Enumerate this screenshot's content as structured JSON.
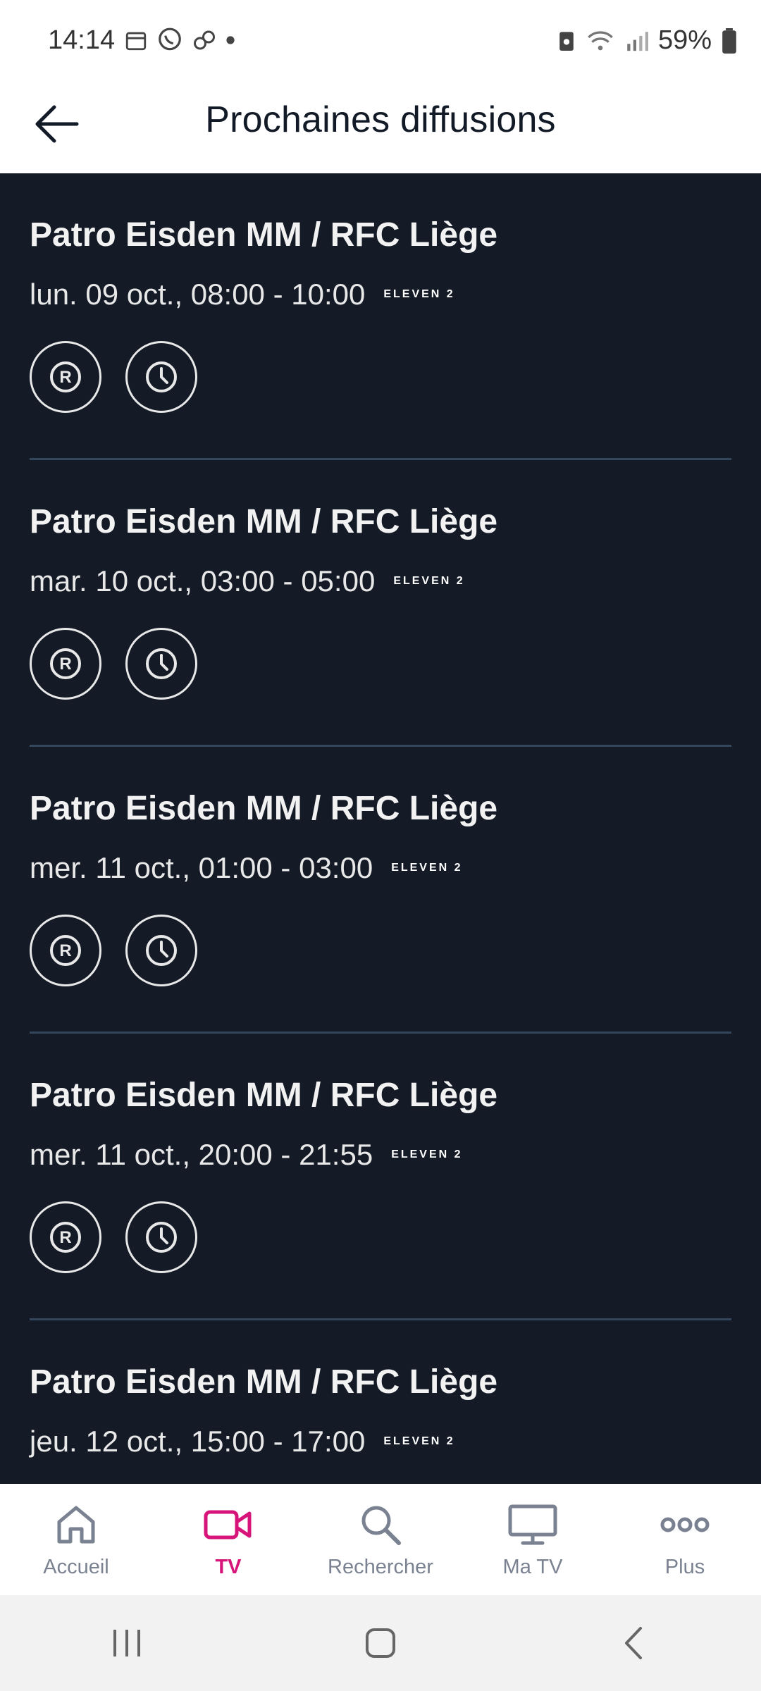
{
  "status_bar": {
    "time": "14:14",
    "battery": "59%"
  },
  "header": {
    "title": "Prochaines diffusions"
  },
  "broadcasts": [
    {
      "title": "Patro Eisden MM / RFC Liège",
      "time": "lun. 09 oct., 08:00 - 10:00",
      "channel": "ELEVEN 2"
    },
    {
      "title": "Patro Eisden MM / RFC Liège",
      "time": "mar. 10 oct., 03:00 - 05:00",
      "channel": "ELEVEN 2"
    },
    {
      "title": "Patro Eisden MM / RFC Liège",
      "time": "mer. 11 oct., 01:00 - 03:00",
      "channel": "ELEVEN 2"
    },
    {
      "title": "Patro Eisden MM / RFC Liège",
      "time": "mer. 11 oct., 20:00 - 21:55",
      "channel": "ELEVEN 2"
    },
    {
      "title": "Patro Eisden MM / RFC Liège",
      "time": "jeu. 12 oct., 15:00 - 17:00",
      "channel": "ELEVEN 2"
    }
  ],
  "bottom_nav": {
    "items": [
      {
        "label": "Accueil",
        "icon": "home-icon"
      },
      {
        "label": "TV",
        "icon": "video-camera-icon",
        "active": true
      },
      {
        "label": "Rechercher",
        "icon": "search-icon"
      },
      {
        "label": "Ma TV",
        "icon": "monitor-icon"
      },
      {
        "label": "Plus",
        "icon": "more-dots-icon"
      }
    ]
  },
  "colors": {
    "accent": "#d6147a",
    "background": "#141b27",
    "divider": "#33465c"
  }
}
